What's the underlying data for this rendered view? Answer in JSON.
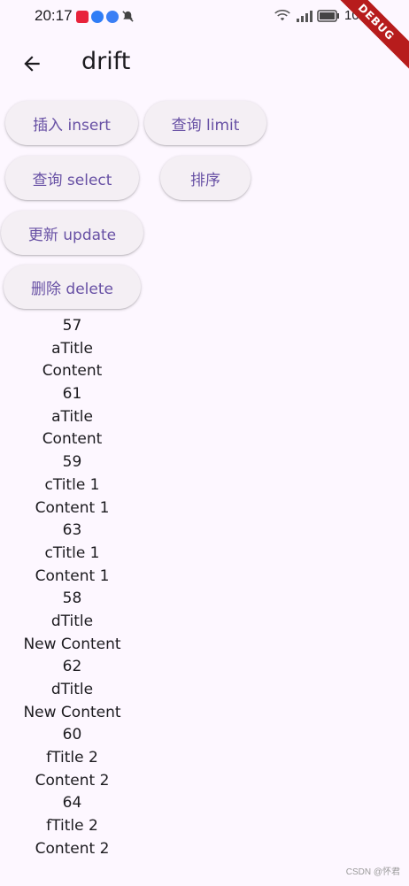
{
  "status_bar": {
    "time": "20:17",
    "battery_text": "100",
    "notification_icons": [
      "app-red-icon",
      "app-blue-icon",
      "music-icon",
      "bell-off-icon"
    ],
    "system_icons": [
      "wifi-icon",
      "signal-icon",
      "battery-icon"
    ]
  },
  "debug_banner": "DEBUG",
  "app_bar": {
    "back_icon": "arrow-back-icon",
    "title": "drift"
  },
  "buttons": {
    "insert": "插入 insert",
    "limit": "查询 limit",
    "select": "查询 select",
    "sort": "排序",
    "update": "更新 update",
    "delete": "删除 delete"
  },
  "records": [
    {
      "id": "57",
      "title": "aTitle",
      "content": "Content"
    },
    {
      "id": "61",
      "title": "aTitle",
      "content": "Content"
    },
    {
      "id": "59",
      "title": "cTitle 1",
      "content": "Content 1"
    },
    {
      "id": "63",
      "title": "cTitle 1",
      "content": "Content 1"
    },
    {
      "id": "58",
      "title": "dTitle",
      "content": "New Content"
    },
    {
      "id": "62",
      "title": "dTitle",
      "content": "New Content"
    },
    {
      "id": "60",
      "title": "fTitle 2",
      "content": "Content 2"
    },
    {
      "id": "64",
      "title": "fTitle 2",
      "content": "Content 2"
    }
  ],
  "watermark": "CSDN @怀君",
  "colors": {
    "background": "#fdf7ff",
    "button_bg": "#f4eff4",
    "button_text": "#6750a4",
    "debug_banner": "#b71c1c"
  }
}
